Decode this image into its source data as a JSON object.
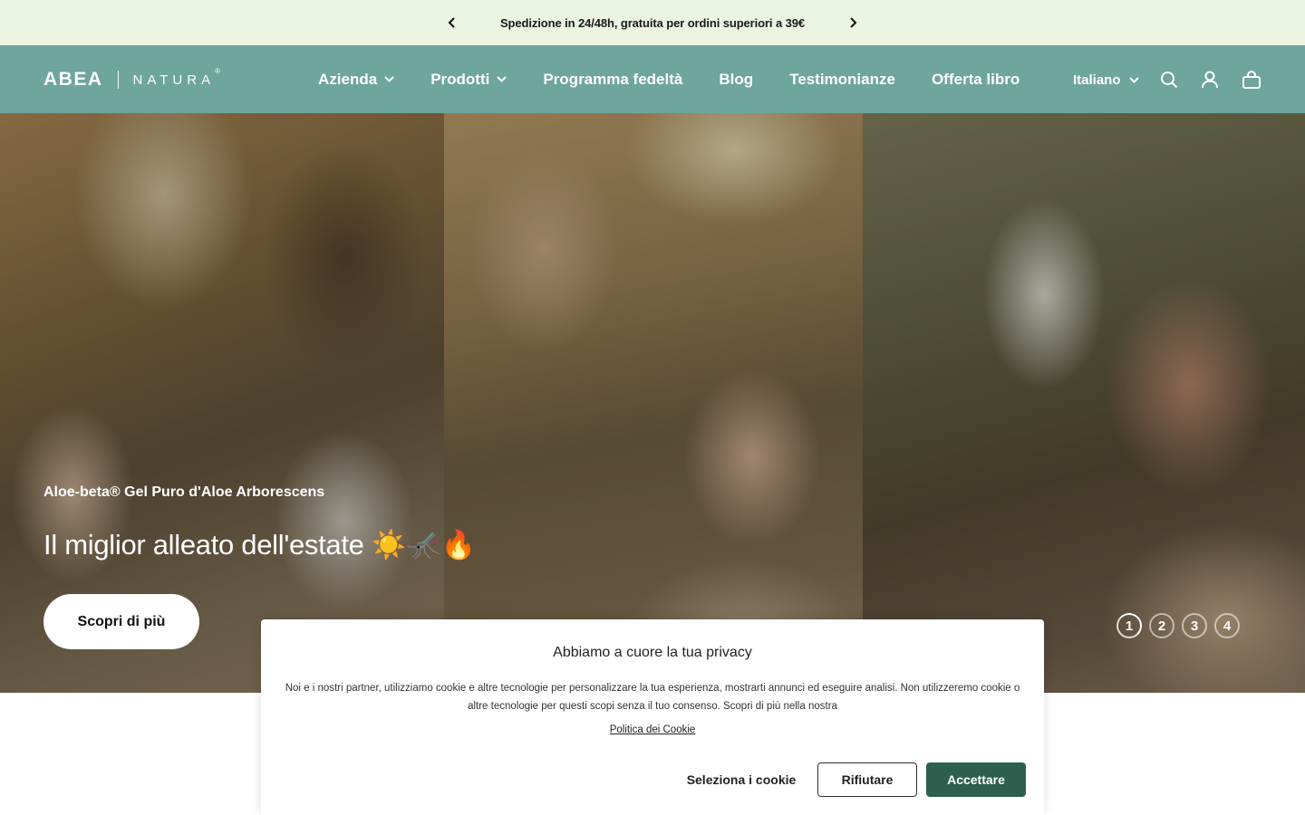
{
  "announcement": {
    "text": "Spedizione in 24/48h, gratuita per ordini superiori a 39€",
    "prev_icon": "chevron-left-icon",
    "next_icon": "chevron-right-icon"
  },
  "header": {
    "logo": {
      "brand_primary": "ABEA",
      "brand_secondary": "NATURA",
      "registered": "®"
    },
    "nav": [
      {
        "label": "Azienda",
        "has_dropdown": true
      },
      {
        "label": "Prodotti",
        "has_dropdown": true
      },
      {
        "label": "Programma fedeltà",
        "has_dropdown": false
      },
      {
        "label": "Blog",
        "has_dropdown": false
      },
      {
        "label": "Testimonianze",
        "has_dropdown": false
      },
      {
        "label": "Offerta libro",
        "has_dropdown": false
      }
    ],
    "language": "Italiano",
    "icons": [
      "search-icon",
      "account-icon",
      "cart-icon"
    ],
    "background": "#6ea59c"
  },
  "hero": {
    "eyebrow": "Aloe-beta® Gel Puro d'Aloe Arborescens",
    "headline": "Il miglior alleato dell'estate ☀️🦟🔥",
    "cta": "Scopri di più",
    "slides": [
      "1",
      "2",
      "3",
      "4"
    ],
    "active_slide": 1
  },
  "cookie": {
    "title": "Abbiamo a cuore la tua privacy",
    "body": "Noi e i nostri partner, utilizziamo cookie e altre tecnologie per personalizzare la tua esperienza, mostrarti annunci ed eseguire analisi. Non utilizzeremo cookie o altre tecnologie per questi scopi senza il tuo consenso. Scopri di più nella nostra",
    "policy_link": "Politica dei Cookie",
    "select_label": "Seleziona i cookie",
    "reject_label": "Rifiutare",
    "accept_label": "Accettare",
    "accept_color": "#2c5f4e"
  },
  "colors": {
    "announcement_bg": "#ebf3e1",
    "header_bg": "#6ea59c",
    "accept_button": "#2c5f4e"
  }
}
